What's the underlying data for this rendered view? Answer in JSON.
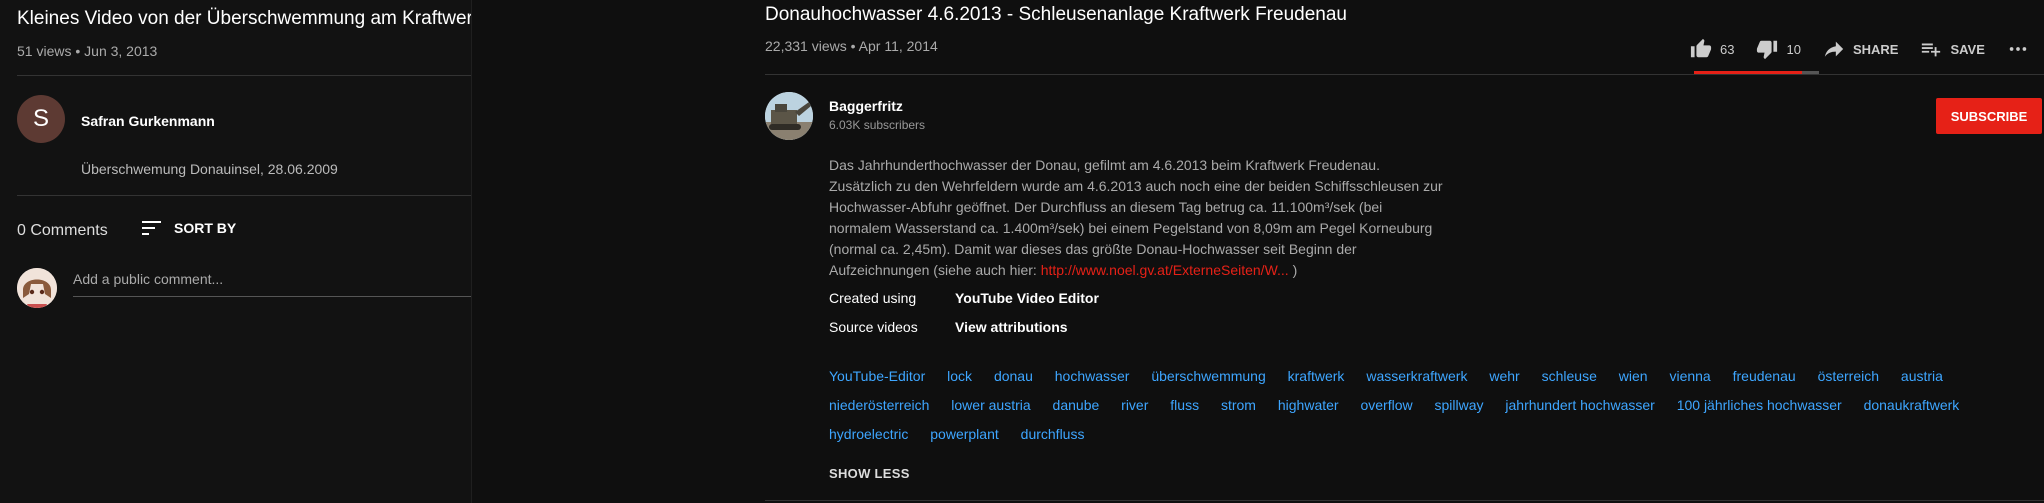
{
  "left_video": {
    "title": "Kleines Video von der Überschwemmung am Kraftwerk Freudenau",
    "views": "51 views",
    "date": "Jun 3, 2013",
    "channel_initial": "S",
    "channel_name": "Safran Gurkenmann",
    "description": "Überschwemung Donauinsel, 28.06.2009",
    "comments_count": "0 Comments",
    "sort_label": "SORT BY",
    "add_comment_placeholder": "Add a public comment..."
  },
  "right_video": {
    "title": "Donauhochwasser 4.6.2013 - Schleusenanlage Kraftwerk Freudenau",
    "views": "22,331 views",
    "date": "Apr 11, 2014",
    "likes": "63",
    "dislikes": "10",
    "like_ratio": 0.86,
    "share_label": "SHARE",
    "save_label": "SAVE",
    "channel_name": "Baggerfritz",
    "subscribers": "6.03K subscribers",
    "subscribe_label": "SUBSCRIBE",
    "description_lines": [
      "Das Jahrhunderthochwasser der Donau, gefilmt am 4.6.2013 beim Kraftwerk Freudenau.",
      "Zusätzlich zu den Wehrfeldern wurde am 4.6.2013 auch noch eine der beiden Schiffsschleusen zur",
      "Hochwasser-Abfuhr geöffnet. Der Durchfluss an diesem Tag betrug ca. 11.100m³/sek (bei",
      "normalem Wasserstand ca. 1.400m³/sek) bei einem Pegelstand von 8,09m am Pegel Korneuburg",
      "(normal ca. 2,45m). Damit war dieses das größte Donau-Hochwasser seit Beginn der"
    ],
    "description_last_prefix": "Aufzeichnungen (siehe auch hier: ",
    "description_link": "http://www.noel.gv.at/ExterneSeiten/W...",
    "description_last_suffix": " )",
    "created_using_label": "Created using",
    "created_using_value": "YouTube Video Editor",
    "source_videos_label": "Source videos",
    "source_videos_value": "View attributions",
    "tags": [
      "YouTube-Editor",
      "lock",
      "donau",
      "hochwasser",
      "überschwemmung",
      "kraftwerk",
      "wasserkraftwerk",
      "wehr",
      "schleuse",
      "wien",
      "vienna",
      "freudenau",
      "österreich",
      "austria",
      "niederösterreich",
      "lower austria",
      "danube",
      "river",
      "fluss",
      "strom",
      "highwater",
      "overflow",
      "spillway",
      "jahrhundert hochwasser",
      "100 jährliches hochwasser",
      "donaukraftwerk",
      "hydroelectric",
      "powerplant",
      "durchfluss"
    ],
    "show_less_label": "SHOW LESS"
  },
  "colors": {
    "background": "#0f0f0f",
    "accent_red": "#e62117",
    "link_blue": "#3ea6ff"
  }
}
